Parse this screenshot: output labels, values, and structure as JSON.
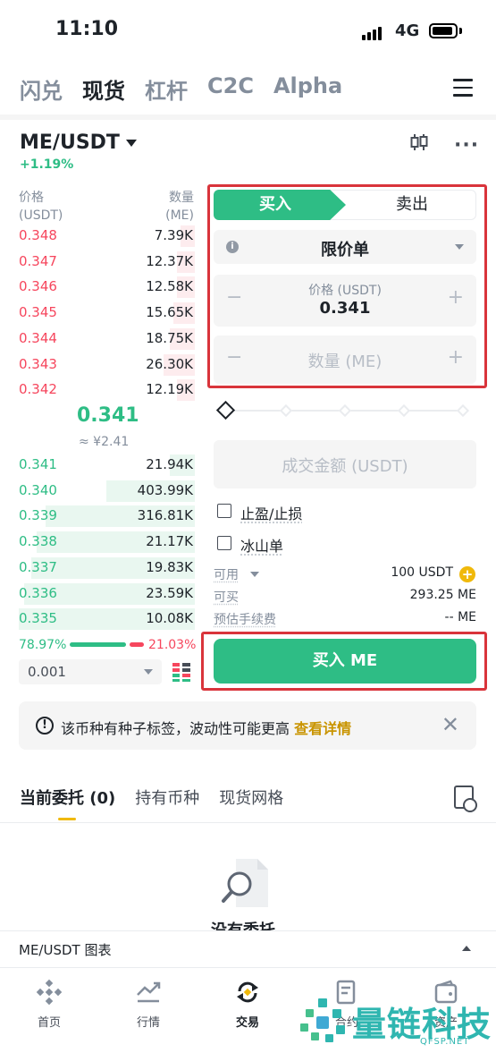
{
  "status_bar": {
    "time": "11:10",
    "network": "4G"
  },
  "top_tabs": [
    {
      "label": "闪兑",
      "active": false
    },
    {
      "label": "现货",
      "active": true
    },
    {
      "label": "杠杆",
      "active": false
    },
    {
      "label": "C2C",
      "active": false
    },
    {
      "label": "Alpha",
      "active": false
    }
  ],
  "pair": {
    "symbol": "ME/USDT",
    "change": "+1.19%"
  },
  "orderbook": {
    "price_header": "价格",
    "price_unit": "(USDT)",
    "qty_header": "数量",
    "qty_unit": "(ME)",
    "asks": [
      {
        "price": "0.348",
        "qty": "7.39K",
        "depth": 0.08
      },
      {
        "price": "0.347",
        "qty": "12.37K",
        "depth": 0.1
      },
      {
        "price": "0.346",
        "qty": "12.58K",
        "depth": 0.1
      },
      {
        "price": "0.345",
        "qty": "15.65K",
        "depth": 0.12
      },
      {
        "price": "0.344",
        "qty": "18.75K",
        "depth": 0.14
      },
      {
        "price": "0.343",
        "qty": "26.30K",
        "depth": 0.18
      },
      {
        "price": "0.342",
        "qty": "12.19K",
        "depth": 0.1
      }
    ],
    "last_price": "0.341",
    "last_price_cny": "≈ ¥2.41",
    "bids": [
      {
        "price": "0.341",
        "qty": "21.94K",
        "depth": 0.14
      },
      {
        "price": "0.340",
        "qty": "403.99K",
        "depth": 0.5
      },
      {
        "price": "0.339",
        "qty": "316.81K",
        "depth": 0.85
      },
      {
        "price": "0.338",
        "qty": "21.17K",
        "depth": 0.9
      },
      {
        "price": "0.337",
        "qty": "19.83K",
        "depth": 0.93
      },
      {
        "price": "0.336",
        "qty": "23.59K",
        "depth": 0.97
      },
      {
        "price": "0.335",
        "qty": "10.08K",
        "depth": 1.0
      }
    ],
    "buy_ratio": "78.97%",
    "sell_ratio": "21.03%",
    "precision": "0.001"
  },
  "order_form": {
    "buy_tab": "买入",
    "sell_tab": "卖出",
    "order_type": "限价单",
    "price_label": "价格 (USDT)",
    "price_value": "0.341",
    "qty_placeholder": "数量 (ME)",
    "total_placeholder": "成交金额 (USDT)",
    "tpsl_label": "止盈/止损",
    "iceberg_label": "冰山单",
    "available_label": "可用",
    "available_value": "100 USDT",
    "can_buy_label": "可买",
    "can_buy_value": "293.25 ME",
    "fee_label": "预估手续费",
    "fee_value": "-- ME",
    "submit_label": "买入 ME",
    "slider_pct": 0
  },
  "notice": {
    "text": "该币种有种子标签，波动性可能更高",
    "link": "查看详情"
  },
  "bottom_tabs": [
    {
      "label": "当前委托 (0)",
      "active": true
    },
    {
      "label": "持有币种",
      "active": false
    },
    {
      "label": "现货网格",
      "active": false
    }
  ],
  "empty_state": "没有委托",
  "chart_bar": {
    "label": "ME/USDT 图表"
  },
  "nav": [
    {
      "label": "首页",
      "icon": "binance-logo-icon"
    },
    {
      "label": "行情",
      "icon": "markets-chart-icon"
    },
    {
      "label": "交易",
      "icon": "trade-swap-icon",
      "active": true
    },
    {
      "label": "合约",
      "icon": "futures-doc-icon"
    },
    {
      "label": "资产",
      "icon": "wallet-icon"
    }
  ],
  "watermark": {
    "text": "量链科技",
    "url": "QFSP.NET"
  },
  "colors": {
    "green": "#2ebd85",
    "red": "#f6465d",
    "gold": "#f0b90b",
    "highlight": "#d9343b"
  }
}
